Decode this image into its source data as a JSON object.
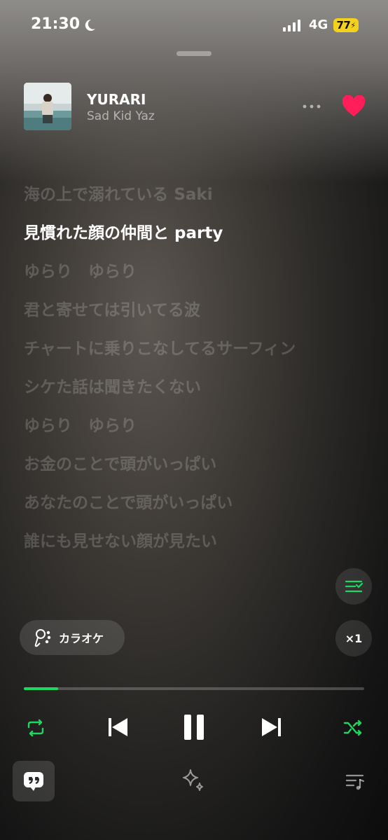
{
  "status_bar": {
    "time": "21:30",
    "network": "4G",
    "battery": "77"
  },
  "track": {
    "title": "YURARI",
    "artist": "Sad Kid Yaz",
    "liked": true,
    "progress": 0.1
  },
  "lyrics": [
    {
      "text": "海の上で溺れている Saki",
      "active": false
    },
    {
      "text": "見慣れた顔の仲間と party",
      "active": true
    },
    {
      "text": "ゆらり　ゆらり",
      "active": false
    },
    {
      "text": "君と寄せては引いてる波",
      "active": false
    },
    {
      "text": "チャートに乗りこなしてるサーフィン",
      "active": false
    },
    {
      "text": "シケた話は聞きたくない",
      "active": false
    },
    {
      "text": "ゆらり　ゆらり",
      "active": false
    },
    {
      "text": "お金のことで頭がいっぱい",
      "active": false
    },
    {
      "text": "あなたのことで頭がいっぱい",
      "active": false
    },
    {
      "text": "誰にも見せない顔が見たい",
      "active": false
    }
  ],
  "karaoke": {
    "label": "カラオケ"
  },
  "speed": {
    "label": "×1"
  },
  "colors": {
    "accent": "#1ed760",
    "heart": "#ff1e5a"
  },
  "icons": [
    "moon-icon",
    "more-icon",
    "heart-icon",
    "queue-icon",
    "karaoke-mic-icon",
    "repeat-icon",
    "previous-icon",
    "pause-icon",
    "next-icon",
    "shuffle-icon",
    "lyrics-icon",
    "sparkle-icon",
    "playlist-icon"
  ]
}
